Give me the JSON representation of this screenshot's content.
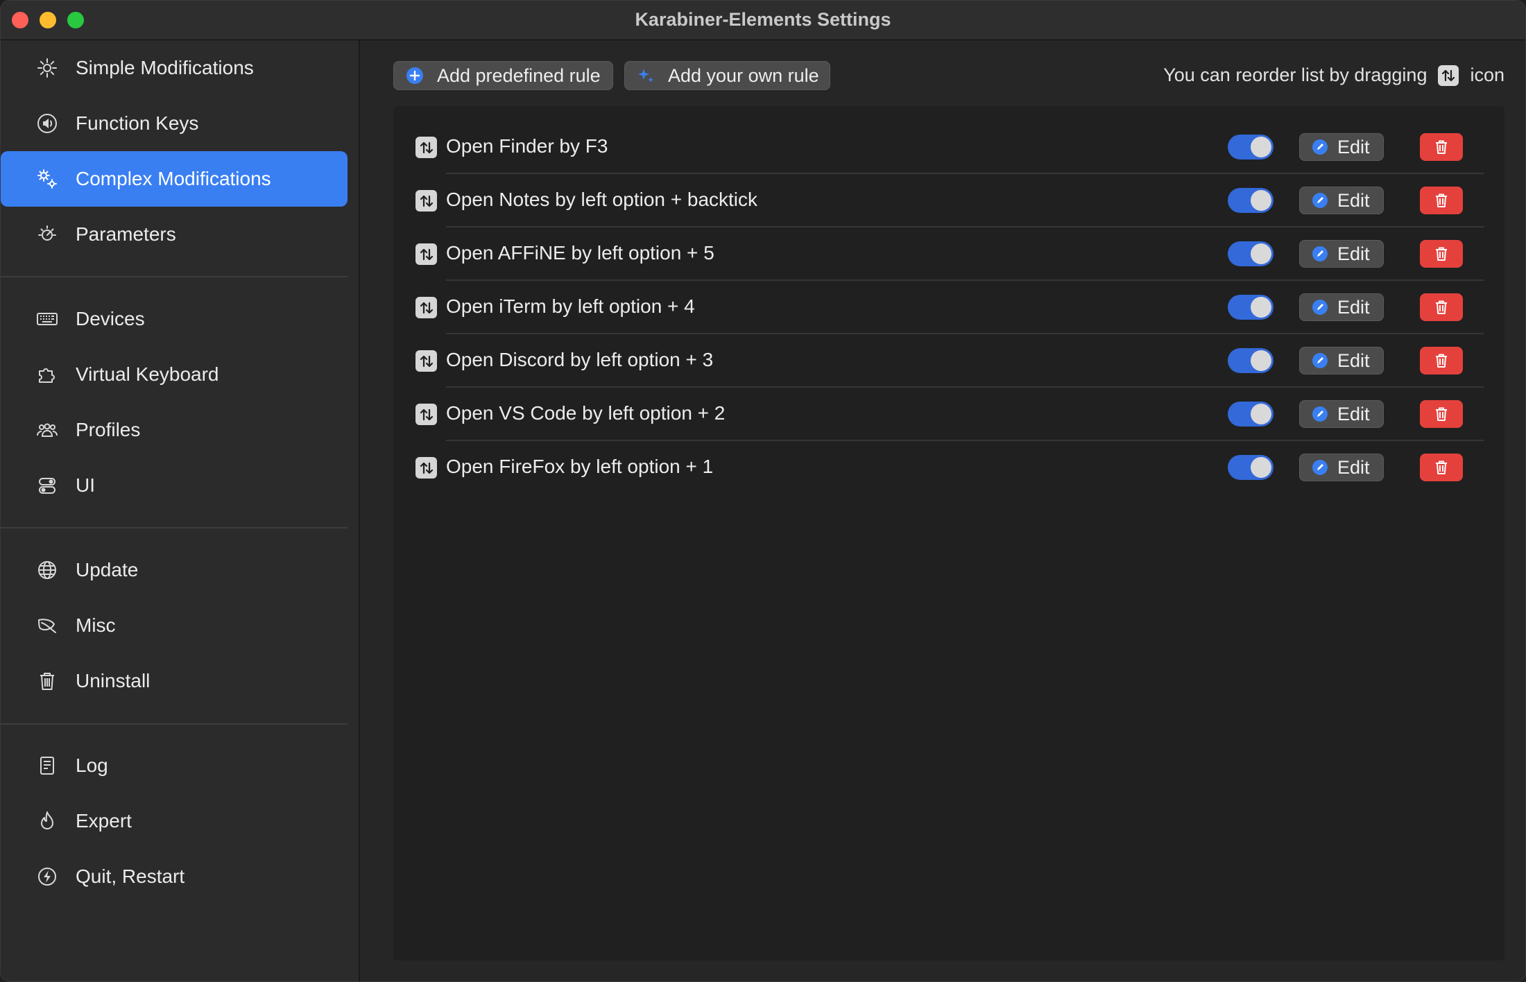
{
  "window": {
    "title": "Karabiner-Elements Settings"
  },
  "sidebar": {
    "items": [
      {
        "label": "Simple Modifications",
        "icon": "gear-icon"
      },
      {
        "label": "Function Keys",
        "icon": "speaker-icon"
      },
      {
        "label": "Complex Modifications",
        "icon": "gears-icon",
        "active": true
      },
      {
        "label": "Parameters",
        "icon": "sun-dial-icon"
      },
      {
        "label": "Devices",
        "icon": "keyboard-icon"
      },
      {
        "label": "Virtual Keyboard",
        "icon": "puzzle-icon"
      },
      {
        "label": "Profiles",
        "icon": "people-icon"
      },
      {
        "label": "UI",
        "icon": "switches-icon"
      },
      {
        "label": "Update",
        "icon": "globe-icon"
      },
      {
        "label": "Misc",
        "icon": "leaf-icon"
      },
      {
        "label": "Uninstall",
        "icon": "trash-icon"
      },
      {
        "label": "Log",
        "icon": "document-icon"
      },
      {
        "label": "Expert",
        "icon": "flame-icon"
      },
      {
        "label": "Quit, Restart",
        "icon": "bolt-icon"
      }
    ]
  },
  "toolbar": {
    "add_predefined_label": "Add predefined rule",
    "add_own_label": "Add your own rule",
    "hint_prefix": "You can reorder list by dragging",
    "hint_suffix": "icon"
  },
  "rules": [
    {
      "label": "Open Finder by F3",
      "enabled": true
    },
    {
      "label": "Open Notes by left option + backtick",
      "enabled": true
    },
    {
      "label": "Open AFFiNE by left option + 5",
      "enabled": true
    },
    {
      "label": "Open iTerm by left option + 4",
      "enabled": true
    },
    {
      "label": "Open Discord by left option + 3",
      "enabled": true
    },
    {
      "label": "Open VS Code by left option + 2",
      "enabled": true
    },
    {
      "label": "Open FireFox by left option + 1",
      "enabled": true
    }
  ],
  "rule_actions": {
    "edit_label": "Edit"
  },
  "colors": {
    "accent": "#3a7ff2",
    "toggle_on": "#3369d9",
    "danger": "#e5413c"
  }
}
